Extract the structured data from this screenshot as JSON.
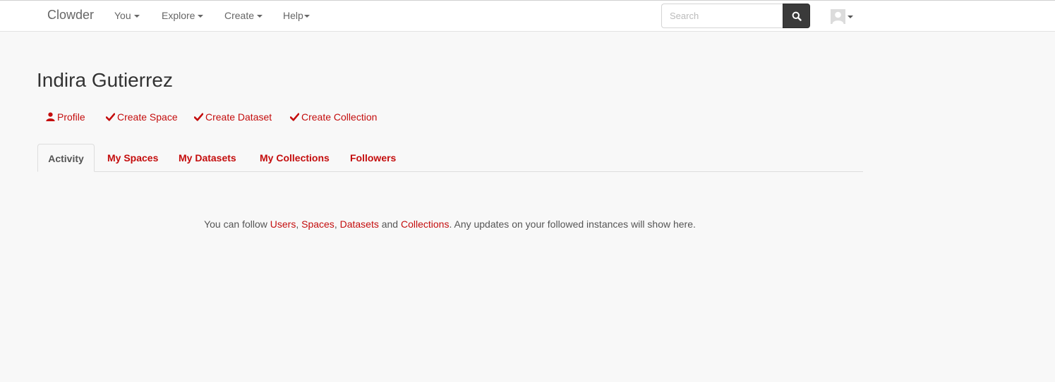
{
  "navbar": {
    "brand": "Clowder",
    "menus": [
      {
        "label": "You"
      },
      {
        "label": "Explore"
      },
      {
        "label": "Create"
      },
      {
        "label": "Help"
      }
    ],
    "search": {
      "placeholder": "Search",
      "value": ""
    },
    "icons": {
      "search": "search-icon",
      "avatar": "user-avatar-icon"
    }
  },
  "profile": {
    "name": "Indira Gutierrez",
    "actions": [
      {
        "label": "Profile",
        "icon": "user-icon"
      },
      {
        "label": "Create Space",
        "icon": "check-icon"
      },
      {
        "label": "Create Dataset",
        "icon": "check-icon"
      },
      {
        "label": "Create Collection",
        "icon": "check-icon"
      }
    ]
  },
  "tabs": [
    {
      "label": "Activity",
      "active": true
    },
    {
      "label": "My Spaces",
      "active": false
    },
    {
      "label": "My Datasets",
      "active": false
    },
    {
      "label": "My Collections",
      "active": false
    },
    {
      "label": "Followers",
      "active": false
    }
  ],
  "activity": {
    "prefix": "You can follow",
    "link_users": "Users",
    "sep1": ",",
    "link_spaces": "Spaces",
    "sep2": ",",
    "link_datasets": "Datasets",
    "and": "and",
    "link_collections": "Collections",
    "suffix": ". Any updates on your followed instances will show here."
  },
  "colors": {
    "accent": "#c40d0d",
    "navbar_bg": "#ffffff",
    "page_bg": "#f8f8f8",
    "search_button": "#3a3a3a"
  }
}
